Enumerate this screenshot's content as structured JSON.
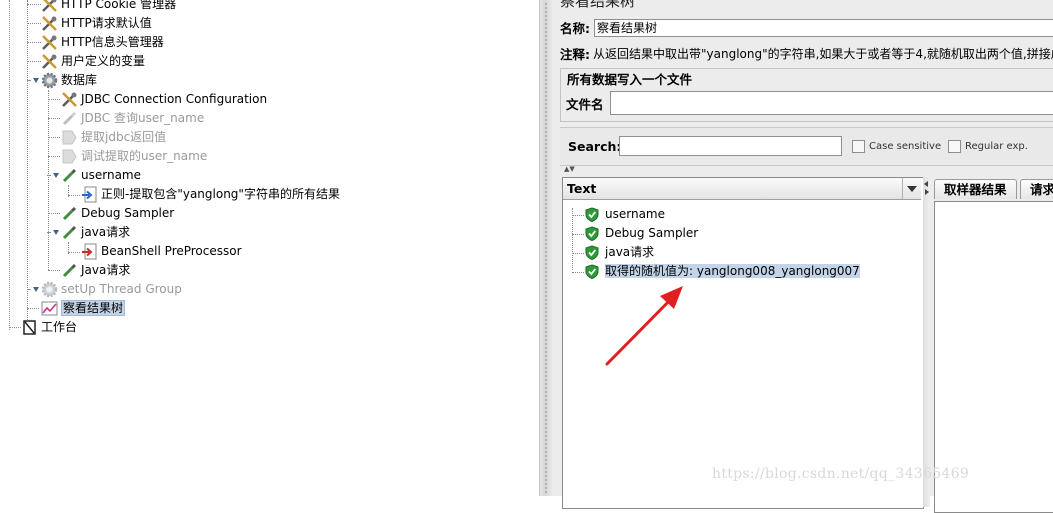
{
  "tree": {
    "items": [
      {
        "label": "HTTP Cookie 管理器",
        "icon": "wrench-screwdriver-icon",
        "dim": false
      },
      {
        "label": "HTTP请求默认值",
        "icon": "wrench-screwdriver-icon",
        "dim": false
      },
      {
        "label": "HTTP信息头管理器",
        "icon": "wrench-screwdriver-icon",
        "dim": false
      },
      {
        "label": "用户定义的变量",
        "icon": "wrench-screwdriver-icon",
        "dim": false
      },
      {
        "label": "数据库",
        "icon": "gear-icon",
        "dim": false
      },
      {
        "label": "JDBC Connection Configuration",
        "icon": "wrench-screwdriver-icon",
        "dim": false
      },
      {
        "label": "JDBC 查询user_name",
        "icon": "pipette-icon",
        "dim": true
      },
      {
        "label": "提取jdbc返回值",
        "icon": "postprocessor-icon",
        "dim": true
      },
      {
        "label": "调试提取的user_name",
        "icon": "postprocessor-icon",
        "dim": true
      },
      {
        "label": "username",
        "icon": "pipette-icon",
        "dim": false
      },
      {
        "label": "正则-提取包含\"yanglong\"字符串的所有结果",
        "icon": "preprocessor-icon",
        "dim": false
      },
      {
        "label": "Debug Sampler",
        "icon": "pipette-icon",
        "dim": false
      },
      {
        "label": "java请求",
        "icon": "pipette-icon",
        "dim": false
      },
      {
        "label": "BeanShell PreProcessor",
        "icon": "preprocessor-icon",
        "dim": false
      },
      {
        "label": "Java请求",
        "icon": "pipette-icon",
        "dim": false
      },
      {
        "label": "setUp Thread Group",
        "icon": "gear-icon",
        "dim": true
      },
      {
        "label": "察看结果树",
        "icon": "graph-icon",
        "dim": false
      },
      {
        "label": "工作台",
        "icon": "workbench-icon",
        "dim": false
      }
    ]
  },
  "panel": {
    "title": "察看结果树",
    "name_label": "名称:",
    "name_value": "察看结果树",
    "comment_label": "注释:",
    "comment_value": "从返回结果中取出带\"yanglong\"的字符串,如果大于或者等于4,就随机取出两个值,拼接成",
    "group_title": "所有数据写入一个文件",
    "filename_label": "文件名",
    "filename_value": "",
    "search_label": "Search:",
    "search_value": "",
    "case_sensitive_label": "Case sensitive",
    "regular_exp_label": "Regular exp."
  },
  "results": {
    "column_header": "Text",
    "rows": [
      {
        "label": "username",
        "status": "success"
      },
      {
        "label": "Debug Sampler",
        "status": "success"
      },
      {
        "label": "java请求",
        "status": "success"
      },
      {
        "label": "取得的随机值为: yanglong008_yanglong007",
        "status": "success"
      }
    ]
  },
  "detail_tabs": [
    "取样器结果",
    "请求"
  ],
  "watermark": "https://blog.csdn.net/qq_34365469",
  "colors": {
    "selection": "#c3d4e8",
    "success_shield": "#2e9a3a",
    "annotation_arrow": "#e02020"
  }
}
